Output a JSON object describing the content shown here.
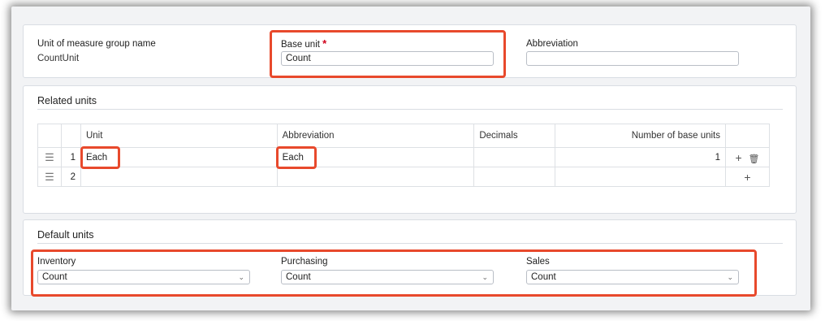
{
  "header": {
    "group_name_label": "Unit of measure group name",
    "group_name_value": "CountUnit",
    "base_unit_label": "Base unit",
    "required_marker": "*",
    "base_unit_value": "Count",
    "abbreviation_label": "Abbreviation",
    "abbreviation_value": ""
  },
  "related_units": {
    "title": "Related units",
    "columns": [
      "Unit",
      "Abbreviation",
      "Decimals",
      "Number of base units"
    ],
    "rows": [
      {
        "index": "1",
        "unit": "Each",
        "abbreviation": "Each",
        "decimals": "",
        "base_units": "1"
      },
      {
        "index": "2",
        "unit": "",
        "abbreviation": "",
        "decimals": "",
        "base_units": ""
      }
    ],
    "handle_glyph": "☰",
    "add_glyph": "+",
    "delete_glyph": "🗑"
  },
  "default_units": {
    "title": "Default units",
    "inventory_label": "Inventory",
    "inventory_value": "Count",
    "purchasing_label": "Purchasing",
    "purchasing_value": "Count",
    "sales_label": "Sales",
    "sales_value": "Count",
    "chevron": "⌄"
  },
  "colors": {
    "highlight": "#e8492c",
    "required": "#d0021b"
  }
}
